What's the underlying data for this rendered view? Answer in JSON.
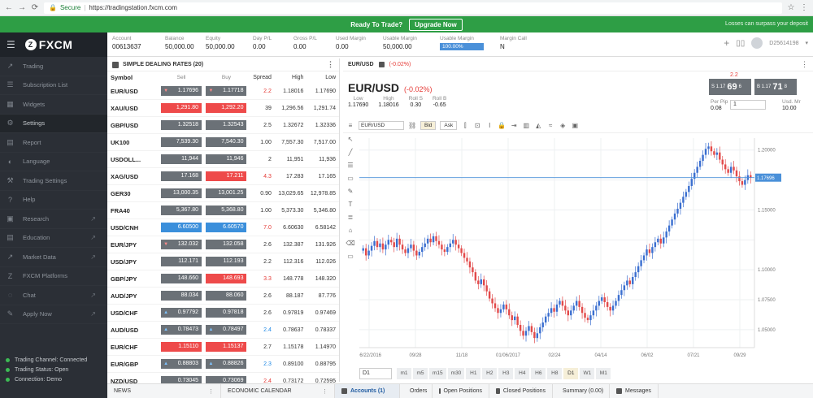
{
  "browser": {
    "secure": "Secure",
    "url": "https://tradingstation.fxcm.com"
  },
  "banner": {
    "text": "Ready To Trade?",
    "button": "Upgrade Now",
    "right": "Losses can surpass your deposit"
  },
  "sidebar": {
    "logo": "FXCM",
    "items": [
      {
        "label": "Trading",
        "icon": "chart-icon"
      },
      {
        "label": "Subscription List",
        "icon": "list-icon"
      },
      {
        "label": "Widgets",
        "icon": "widgets-icon"
      },
      {
        "label": "Settings",
        "icon": "gear-icon"
      },
      {
        "label": "Report",
        "icon": "report-icon"
      },
      {
        "label": "Language",
        "icon": "language-icon"
      },
      {
        "label": "Trading Settings",
        "icon": "settings-icon"
      },
      {
        "label": "Help",
        "icon": "help-icon"
      },
      {
        "label": "Research",
        "icon": "research-icon",
        "external": true
      },
      {
        "label": "Education",
        "icon": "education-icon",
        "external": true
      },
      {
        "label": "Market Data",
        "icon": "market-icon",
        "external": true
      },
      {
        "label": "FXCM Platforms",
        "icon": "fxcm-icon"
      },
      {
        "label": "Chat",
        "icon": "chat-icon",
        "external": true
      },
      {
        "label": "Apply Now",
        "icon": "apply-icon",
        "external": true
      }
    ],
    "status": [
      {
        "label": "Trading Channel: Connected"
      },
      {
        "label": "Trading Status: Open"
      },
      {
        "label": "Connection: Demo"
      }
    ]
  },
  "account": {
    "fields": [
      {
        "label": "Account",
        "value": "00613637"
      },
      {
        "label": "Balance",
        "value": "50,000.00"
      },
      {
        "label": "Equity",
        "value": "50,000.00"
      },
      {
        "label": "Day P/L",
        "value": "0.00"
      },
      {
        "label": "Gross P/L",
        "value": "0.00"
      },
      {
        "label": "Used Margin",
        "value": "0.00"
      },
      {
        "label": "Usable Margin",
        "value": "50,000.00"
      },
      {
        "label": "Usable Margin",
        "value": "100.00%",
        "usage": 1.0
      },
      {
        "label": "Margin Call",
        "value": "N"
      }
    ],
    "user": "D25614198"
  },
  "dealing": {
    "title": "SIMPLE DEALING RATES (20)",
    "columns": [
      "Symbol",
      "Sell",
      "Buy",
      "Spread",
      "High",
      "Low"
    ],
    "rows": [
      {
        "symbol": "EUR/USD",
        "sell": "1.17696",
        "buy": "1.17718",
        "spread": "2.2",
        "high": "1.18016",
        "low": "1.17690",
        "sell_c": "grey",
        "buy_c": "grey",
        "sp_c": "red",
        "sell_arr": "▼",
        "buy_arr": "▼"
      },
      {
        "symbol": "XAU/USD",
        "sell": "1,291.80",
        "buy": "1,292.20",
        "spread": "39",
        "high": "1,296.56",
        "low": "1,291.74",
        "sell_c": "red",
        "buy_c": "red",
        "sp_c": "",
        "sell_arr": "",
        "buy_arr": ""
      },
      {
        "symbol": "GBP/USD",
        "sell": "1.32518",
        "buy": "1.32543",
        "spread": "2.5",
        "high": "1.32672",
        "low": "1.32336",
        "sell_c": "grey",
        "buy_c": "grey",
        "sp_c": "",
        "sell_arr": "",
        "buy_arr": ""
      },
      {
        "symbol": "UK100",
        "sell": "7,539.30",
        "buy": "7,540.30",
        "spread": "1.00",
        "high": "7,557.30",
        "low": "7,517.00",
        "sell_c": "grey",
        "buy_c": "grey",
        "sp_c": "",
        "sell_arr": "",
        "buy_arr": ""
      },
      {
        "symbol": "USDOLL...",
        "sell": "11,944",
        "buy": "11,946",
        "spread": "2",
        "high": "11,951",
        "low": "11,936",
        "sell_c": "grey",
        "buy_c": "grey",
        "sp_c": "",
        "sell_arr": "",
        "buy_arr": ""
      },
      {
        "symbol": "XAG/USD",
        "sell": "17.168",
        "buy": "17.211",
        "spread": "4.3",
        "high": "17.283",
        "low": "17.165",
        "sell_c": "grey",
        "buy_c": "red",
        "sp_c": "red",
        "sell_arr": "",
        "buy_arr": ""
      },
      {
        "symbol": "GER30",
        "sell": "13,000.35",
        "buy": "13,001.25",
        "spread": "0.90",
        "high": "13,029.65",
        "low": "12,978.85",
        "sell_c": "grey",
        "buy_c": "grey",
        "sp_c": "",
        "sell_arr": "",
        "buy_arr": ""
      },
      {
        "symbol": "FRA40",
        "sell": "5,367.80",
        "buy": "5,368.80",
        "spread": "1.00",
        "high": "5,373.30",
        "low": "5,346.80",
        "sell_c": "grey",
        "buy_c": "grey",
        "sp_c": "",
        "sell_arr": "",
        "buy_arr": ""
      },
      {
        "symbol": "USD/CNH",
        "sell": "6.60500",
        "buy": "6.60570",
        "spread": "7.0",
        "high": "6.60630",
        "low": "6.58142",
        "sell_c": "blue",
        "buy_c": "blue",
        "sp_c": "red",
        "sell_arr": "",
        "buy_arr": ""
      },
      {
        "symbol": "EUR/JPY",
        "sell": "132.032",
        "buy": "132.058",
        "spread": "2.6",
        "high": "132.387",
        "low": "131.926",
        "sell_c": "grey",
        "buy_c": "grey",
        "sp_c": "",
        "sell_arr": "▼",
        "buy_arr": ""
      },
      {
        "symbol": "USD/JPY",
        "sell": "112.171",
        "buy": "112.193",
        "spread": "2.2",
        "high": "112.316",
        "low": "112.026",
        "sell_c": "grey",
        "buy_c": "grey",
        "sp_c": "",
        "sell_arr": "",
        "buy_arr": ""
      },
      {
        "symbol": "GBP/JPY",
        "sell": "148.660",
        "buy": "148.693",
        "spread": "3.3",
        "high": "148.778",
        "low": "148.320",
        "sell_c": "grey",
        "buy_c": "red",
        "sp_c": "red",
        "sell_arr": "",
        "buy_arr": ""
      },
      {
        "symbol": "AUD/JPY",
        "sell": "88.034",
        "buy": "88.060",
        "spread": "2.6",
        "high": "88.187",
        "low": "87.776",
        "sell_c": "grey",
        "buy_c": "grey",
        "sp_c": "",
        "sell_arr": "",
        "buy_arr": ""
      },
      {
        "symbol": "USD/CHF",
        "sell": "0.97792",
        "buy": "0.97818",
        "spread": "2.6",
        "high": "0.97819",
        "low": "0.97469",
        "sell_c": "grey",
        "buy_c": "grey",
        "sp_c": "",
        "sell_arr": "▲",
        "buy_arr": ""
      },
      {
        "symbol": "AUD/USD",
        "sell": "0.78473",
        "buy": "0.78497",
        "spread": "2.4",
        "high": "0.78637",
        "low": "0.78337",
        "sell_c": "grey",
        "buy_c": "grey",
        "sp_c": "blue",
        "sell_arr": "▲",
        "buy_arr": "▲"
      },
      {
        "symbol": "EUR/CHF",
        "sell": "1.15110",
        "buy": "1.15137",
        "spread": "2.7",
        "high": "1.15178",
        "low": "1.14970",
        "sell_c": "red",
        "buy_c": "red",
        "sp_c": "",
        "sell_arr": "",
        "buy_arr": ""
      },
      {
        "symbol": "EUR/GBP",
        "sell": "0.88803",
        "buy": "0.88826",
        "spread": "2.3",
        "high": "0.89100",
        "low": "0.88795",
        "sell_c": "grey",
        "buy_c": "grey",
        "sp_c": "blue",
        "sell_arr": "▲",
        "buy_arr": "▲"
      },
      {
        "symbol": "NZD/USD",
        "sell": "0.73045",
        "buy": "0.73069",
        "spread": "2.4",
        "high": "0.73172",
        "low": "0.72595",
        "sell_c": "grey",
        "buy_c": "grey",
        "sp_c": "red",
        "sell_arr": "",
        "buy_arr": ""
      }
    ]
  },
  "chart_panel": {
    "tab_symbol": "EUR/USD",
    "tab_change": "(-0.02%)",
    "symbol": "EUR/USD",
    "change": "(-0.02%)",
    "stats": [
      {
        "label": "Low",
        "value": "1.17690"
      },
      {
        "label": "High",
        "value": "1.18016"
      },
      {
        "label": "Roll S",
        "value": "0.30"
      },
      {
        "label": "Roll B",
        "value": "-0.65"
      }
    ],
    "sell_quote": {
      "pre": "S 1.17",
      "big": "69",
      "sup": "6"
    },
    "buy_quote": {
      "pre": "B 1.17",
      "big": "71",
      "sup": "8"
    },
    "spread_tag": "2.2",
    "per_pip_label": "Per Pip",
    "per_pip": "0.08",
    "qty": "1",
    "usd_mr_label": "Usd. Mr",
    "usd_mr": "10.00",
    "toolbar": {
      "pair": "EUR/USD",
      "bid": "Bid",
      "ask": "Ask"
    },
    "timeframes": [
      "m1",
      "m5",
      "m15",
      "m30",
      "H1",
      "H2",
      "H3",
      "H4",
      "H6",
      "H8",
      "D1",
      "W1",
      "M1"
    ],
    "active_tf": "D1",
    "tf_select": "D1"
  },
  "chart_data": {
    "type": "candlestick",
    "symbol": "EUR/USD",
    "period": "D1",
    "x_ticks": [
      "06/22/2016",
      "09/28",
      "11/18",
      "01/06/2017",
      "02/24",
      "04/14",
      "06/02",
      "07/21",
      "09/29"
    ],
    "y_ticks": [
      "1.20000",
      "1.15000",
      "1.10000",
      "1.07500",
      "1.05000"
    ],
    "ylim": [
      1.035,
      1.21
    ],
    "current_price": "1.17696",
    "current_price_value": 1.17696,
    "closes": [
      1.118,
      1.112,
      1.116,
      1.12,
      1.124,
      1.119,
      1.122,
      1.117,
      1.121,
      1.125,
      1.123,
      1.119,
      1.126,
      1.121,
      1.117,
      1.114,
      1.118,
      1.121,
      1.116,
      1.112,
      1.115,
      1.119,
      1.122,
      1.126,
      1.123,
      1.128,
      1.124,
      1.121,
      1.117,
      1.115,
      1.119,
      1.122,
      1.125,
      1.121,
      1.118,
      1.114,
      1.11,
      1.107,
      1.102,
      1.098,
      1.091,
      1.088,
      1.092,
      1.087,
      1.082,
      1.076,
      1.072,
      1.068,
      1.064,
      1.067,
      1.071,
      1.067,
      1.062,
      1.058,
      1.061,
      1.054,
      1.049,
      1.045,
      1.049,
      1.053,
      1.048,
      1.043,
      1.047,
      1.052,
      1.056,
      1.061,
      1.064,
      1.068,
      1.065,
      1.071,
      1.074,
      1.07,
      1.066,
      1.062,
      1.066,
      1.07,
      1.074,
      1.069,
      1.064,
      1.06,
      1.058,
      1.062,
      1.066,
      1.07,
      1.074,
      1.077,
      1.073,
      1.069,
      1.066,
      1.07,
      1.074,
      1.079,
      1.083,
      1.087,
      1.091,
      1.088,
      1.094,
      1.098,
      1.103,
      1.108,
      1.112,
      1.117,
      1.114,
      1.119,
      1.123,
      1.126,
      1.122,
      1.127,
      1.132,
      1.137,
      1.142,
      1.147,
      1.151,
      1.156,
      1.161,
      1.165,
      1.17,
      1.176,
      1.181,
      1.186,
      1.191,
      1.196,
      1.201,
      1.203,
      1.199,
      1.196,
      1.198,
      1.192,
      1.188,
      1.184,
      1.181,
      1.186,
      1.183,
      1.178,
      1.174,
      1.171,
      1.175,
      1.179,
      1.177
    ]
  },
  "bottom_tabs": [
    {
      "label": "NEWS"
    },
    {
      "label": "ECONOMIC CALENDAR"
    },
    {
      "label": "Accounts (1)",
      "active": true
    },
    {
      "label": "Orders"
    },
    {
      "label": "Open Positions"
    },
    {
      "label": "Closed Positions"
    },
    {
      "label": "Summary (0.00)"
    },
    {
      "label": "Messages"
    }
  ],
  "colors": {
    "green": "#2e9e45",
    "sell_red": "#ee4a4a",
    "buy_blue": "#3b8fdb",
    "grey_price": "#6b7177",
    "sidebar": "#2b2f36",
    "candle_up": "#3b6fd0",
    "candle_down": "#e24a4a"
  }
}
